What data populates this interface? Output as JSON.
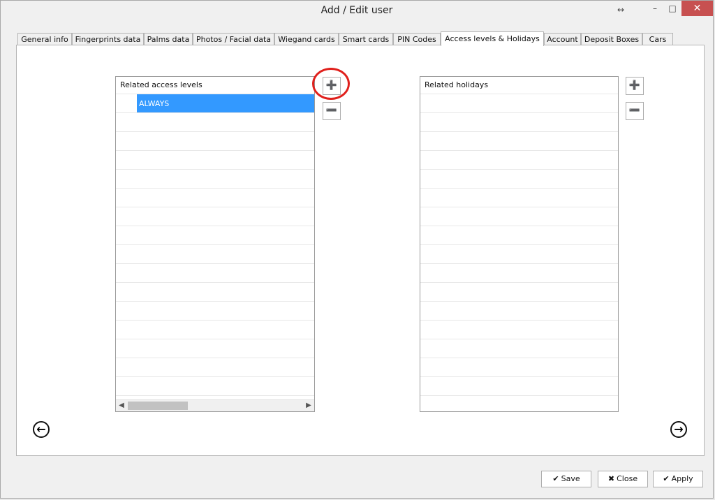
{
  "window": {
    "title": "Add / Edit user"
  },
  "titlebar_icons": {
    "resize": "↔",
    "minimize": "–",
    "maximize": "□",
    "close": "✕"
  },
  "tabs": [
    {
      "label": "General info"
    },
    {
      "label": "Fingerprints data"
    },
    {
      "label": "Palms data"
    },
    {
      "label": "Photos / Facial data"
    },
    {
      "label": "Wiegand cards"
    },
    {
      "label": "Smart cards"
    },
    {
      "label": "PIN Codes"
    },
    {
      "label": "Access levels & Holidays",
      "active": true
    },
    {
      "label": "Account"
    },
    {
      "label": "Deposit Boxes"
    },
    {
      "label": "Cars"
    }
  ],
  "access_levels": {
    "header": "Related access levels",
    "rows": [
      "ALWAYS"
    ]
  },
  "holidays": {
    "header": "Related holidays",
    "rows": []
  },
  "icons": {
    "add": "plus-icon",
    "remove": "minus-icon",
    "prev": "arrow-left-circle-icon",
    "next": "arrow-right-circle-icon",
    "check": "check-icon",
    "close": "x-icon"
  },
  "footer": {
    "save_label": "Save",
    "close_label": "Close",
    "apply_label": "Apply"
  },
  "colors": {
    "selection": "#3399ff",
    "highlight": "#e0201c",
    "close_button": "#c75050"
  }
}
